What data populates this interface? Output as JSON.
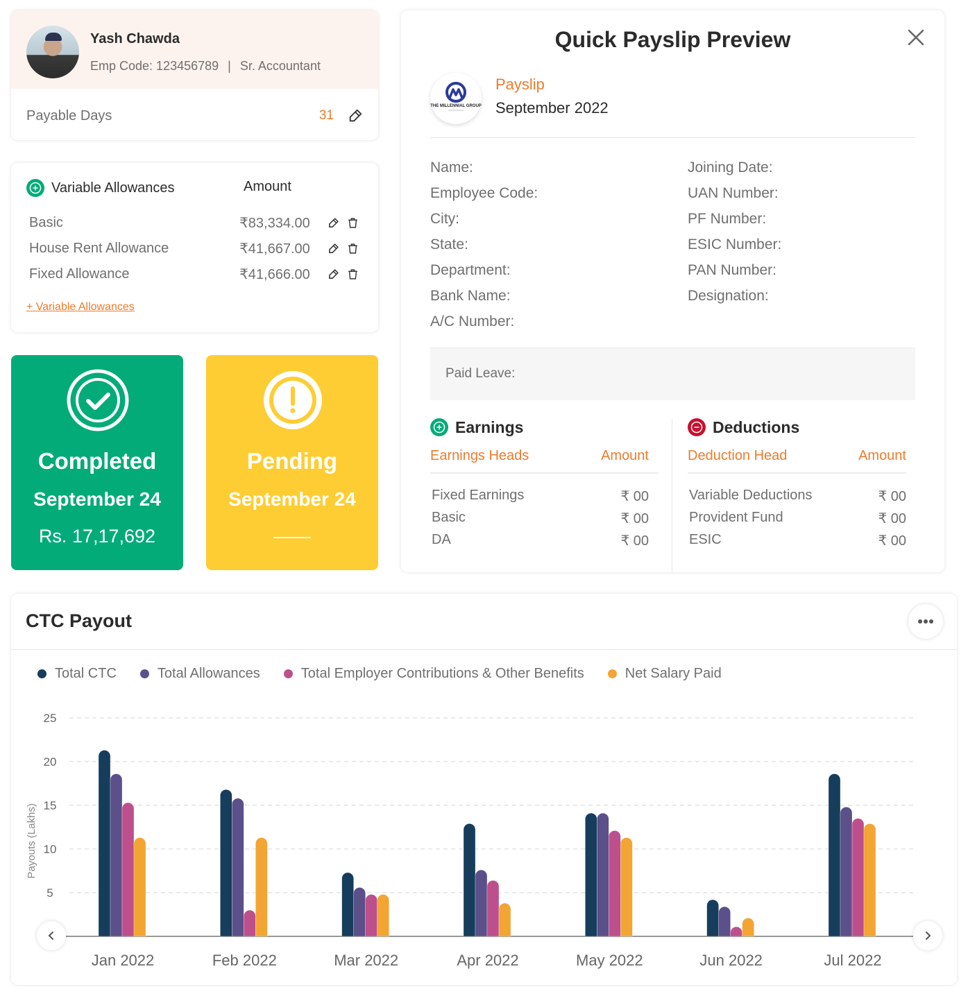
{
  "profile": {
    "name": "Yash Chawda",
    "emp_code_label": "Emp Code: 123456789",
    "separator": "|",
    "designation": "Sr. Accountant",
    "payable_days_label": "Payable Days",
    "payable_days_value": "31"
  },
  "allowances": {
    "title": "Variable Allowances",
    "amount_header": "Amount",
    "items": [
      {
        "name": "Basic",
        "amount": "₹83,334.00"
      },
      {
        "name": "House Rent Allowance",
        "amount": "₹41,667.00"
      },
      {
        "name": "Fixed Allowance",
        "amount": "₹41,666.00"
      }
    ],
    "add_link": "+ Variable Allowances"
  },
  "status_tiles": {
    "completed": {
      "title": "Completed",
      "date": "September 24",
      "amount": "Rs. 17,17,692",
      "color": "#03ab79"
    },
    "pending": {
      "title": "Pending",
      "date": "September 24",
      "amount": "——",
      "color": "#fdcd33"
    }
  },
  "payslip": {
    "title": "Quick Payslip Preview",
    "company_logo_text": "THE MILLENNIAL GROUP",
    "label": "Payslip",
    "period": "September 2022",
    "fields_left": [
      "Name:",
      "Employee Code:",
      "City:",
      "State:",
      "Department:",
      "Bank Name:",
      "A/C Number:"
    ],
    "fields_right": [
      "Joining Date:",
      "UAN Number:",
      "PF Number:",
      "ESIC Number:",
      "PAN Number:",
      "Designation:"
    ],
    "paid_leave_label": "Paid Leave:",
    "earnings": {
      "title": "Earnings",
      "col_head": "Earnings Heads",
      "col_amount": "Amount",
      "rows": [
        {
          "name": "Fixed Earnings",
          "amount": "₹ 00"
        },
        {
          "name": "Basic",
          "amount": "₹ 00"
        },
        {
          "name": "DA",
          "amount": "₹ 00"
        }
      ]
    },
    "deductions": {
      "title": "Deductions",
      "col_head": "Deduction Head",
      "col_amount": "Amount",
      "rows": [
        {
          "name": "Variable Deductions",
          "amount": "₹ 00"
        },
        {
          "name": "Provident Fund",
          "amount": "₹ 00"
        },
        {
          "name": "ESIC",
          "amount": "₹ 00"
        }
      ]
    }
  },
  "ctc": {
    "title": "CTC Payout"
  },
  "colors": {
    "accent_orange": "#ee7b2c",
    "green": "#03ab79",
    "yellow": "#fdcd33",
    "red": "#c8102e"
  },
  "chart_data": {
    "type": "bar",
    "title": "CTC Payout",
    "xlabel": "",
    "ylabel": "Payouts (Lakhs)",
    "ylim": [
      0,
      25
    ],
    "yticks": [
      5,
      10,
      15,
      20,
      25
    ],
    "grid": true,
    "legend_position": "top-left",
    "categories": [
      "Jan 2022",
      "Feb 2022",
      "Mar 2022",
      "Apr 2022",
      "May 2022",
      "Jun 2022",
      "Jul 2022"
    ],
    "series": [
      {
        "name": "Total CTC",
        "color": "#163d5c",
        "values": [
          21.3,
          16.8,
          7.3,
          12.9,
          14.1,
          4.2,
          18.6
        ]
      },
      {
        "name": "Total Allowances",
        "color": "#5b5089",
        "values": [
          18.6,
          15.8,
          5.6,
          7.6,
          14.1,
          3.4,
          14.8
        ]
      },
      {
        "name": "Total Employer Contributions & Other Benefits",
        "color": "#bd4f8d",
        "values": [
          15.3,
          3.0,
          4.8,
          6.4,
          12.1,
          1.1,
          13.5
        ]
      },
      {
        "name": "Net Salary Paid",
        "color": "#f2a533",
        "values": [
          11.3,
          11.3,
          4.8,
          3.8,
          11.3,
          2.1,
          12.9
        ]
      }
    ]
  }
}
